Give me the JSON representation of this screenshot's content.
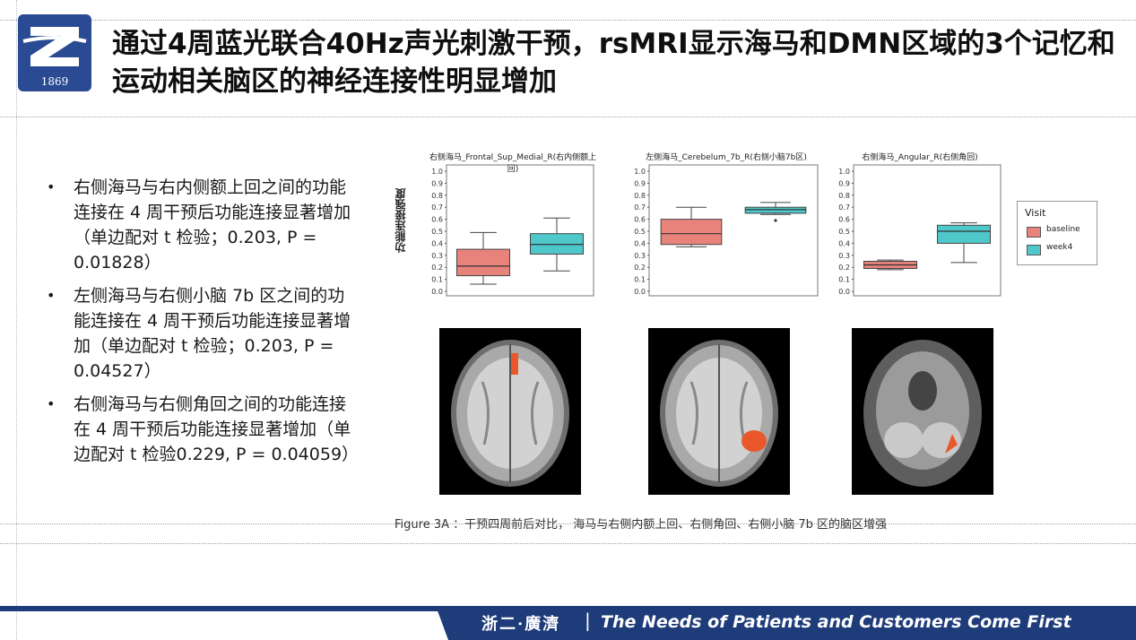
{
  "logo": {
    "year": "1869"
  },
  "title": "通过4周蓝光联合40Hz声光刺激干预，rsMRI显示海马和DMN区域的3个记忆和运动相关脑区的神经连接性明显增加",
  "bullets": [
    "右侧海马与右内侧额上回之间的功能连接在 4 周干预后功能连接显著增加（单边配对 t 检验；0.203, P = 0.01828）",
    "左侧海马与右侧小脑 7b 区之间的功能连接在 4 周干预后功能连接显著增加（单边配对 t 检验；0.203, P = 0.04527）",
    "右侧海马与右侧角回之间的功能连接在 4 周干预后功能连接显著增加（单边配对 t 检验0.229, P = 0.04059）"
  ],
  "bullet_symbol": "•",
  "y_axis_label": "功能连接强度",
  "chart_data": [
    {
      "type": "box",
      "title": "右侧海马_Frontal_Sup_Medial_R(右内侧额上回)",
      "ylim": [
        0.0,
        1.0
      ],
      "yticks": [
        "0.0",
        "0.1",
        "0.2",
        "0.3",
        "0.4",
        "0.5",
        "0.6",
        "0.7",
        "0.8",
        "0.9",
        "1.0"
      ],
      "series": [
        {
          "name": "baseline",
          "color": "#e8837c",
          "min": 0.06,
          "q1": 0.13,
          "median": 0.21,
          "q3": 0.35,
          "max": 0.49,
          "outliers": []
        },
        {
          "name": "week4",
          "color": "#4fc8cc",
          "min": 0.17,
          "q1": 0.31,
          "median": 0.39,
          "q3": 0.48,
          "max": 0.61,
          "outliers": []
        }
      ]
    },
    {
      "type": "box",
      "title": "左侧海马_Cerebelum_7b_R(右侧小脑7b区)",
      "ylim": [
        0.0,
        1.0
      ],
      "yticks": [
        "0.0",
        "0.1",
        "0.2",
        "0.3",
        "0.4",
        "0.5",
        "0.6",
        "0.7",
        "0.8",
        "0.9",
        "1.0"
      ],
      "series": [
        {
          "name": "baseline",
          "color": "#e8837c",
          "min": 0.37,
          "q1": 0.39,
          "median": 0.48,
          "q3": 0.6,
          "max": 0.7,
          "outliers": []
        },
        {
          "name": "week4",
          "color": "#4fc8cc",
          "min": 0.64,
          "q1": 0.65,
          "median": 0.68,
          "q3": 0.7,
          "max": 0.74,
          "outliers": [
            0.59
          ]
        }
      ]
    },
    {
      "type": "box",
      "title": "右侧海马_Angular_R(右侧角回)",
      "ylim": [
        0.0,
        1.0
      ],
      "yticks": [
        "0.0",
        "0.1",
        "0.2",
        "0.3",
        "0.4",
        "0.5",
        "0.6",
        "0.7",
        "0.8",
        "0.9",
        "1.0"
      ],
      "series": [
        {
          "name": "baseline",
          "color": "#e8837c",
          "min": 0.18,
          "q1": 0.19,
          "median": 0.22,
          "q3": 0.25,
          "max": 0.26,
          "outliers": []
        },
        {
          "name": "week4",
          "color": "#4fc8cc",
          "min": 0.24,
          "q1": 0.4,
          "median": 0.5,
          "q3": 0.55,
          "max": 0.57,
          "outliers": []
        }
      ]
    }
  ],
  "legend": {
    "title": "Visit",
    "items": [
      "baseline",
      "week4"
    ]
  },
  "caption": "Figure 3A ：干预四周前后对比，  海马与右侧内额上回、右侧角回、右侧小脑 7b 区的脑区增强",
  "footer": {
    "chinese": "浙二·廣濟",
    "separator": "|",
    "slogan": "The Needs of Patients and Customers Come First"
  }
}
